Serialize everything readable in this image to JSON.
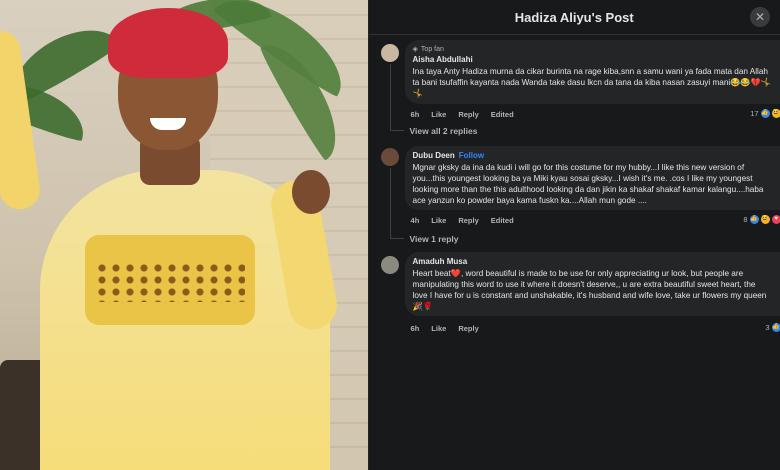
{
  "post": {
    "title": "Hadiza Aliyu's Post"
  },
  "icons": {
    "close": "close-icon",
    "top_fan": "top-fan-badge-icon"
  },
  "colors": {
    "like": "#2d88ff",
    "love": "#f33e58",
    "haha": "#f7b125",
    "follow": "#2d88ff"
  },
  "comments": [
    {
      "badge": "Top fan",
      "name": "Aisha Abdullahi",
      "text": "Ina taya Anty Hadiza murna da cikar burinta na rage kiba,snn a samu wani ya fada mata dan Allah ta bani tsufaffin kayanta nada Wanda take dasu lkcn da tana da kiba nasan zasuyi mani😂😂💔🤸🤸",
      "time": "6h",
      "like": "Like",
      "reply": "Reply",
      "edited": "Edited",
      "reactions": "17",
      "view_replies": "View all 2 replies"
    },
    {
      "name": "Dubu Deen",
      "follow": "Follow",
      "text": "Mgnar gksky da ina da kudi i will go for this costume for my hubby...I like this new version of you...this youngest looking ba ya Miki kyau sosai gksky...I wish it's me. .cos I like my youngest looking more than the this adulthood looking da dan jikin ka shakaf shakaf kamar kalangu....haba ace yanzun ko powder baya kama fuskn ka....Allah mun gode ....",
      "time": "4h",
      "like": "Like",
      "reply": "Reply",
      "edited": "Edited",
      "reactions": "8",
      "view_replies": "View 1 reply"
    },
    {
      "name": "Amaduh Musa",
      "text": "Heart beat❤️, word beautiful is made to be use for only appreciating ur look, but people are manipulating this word to use it where it doesn't deserve,, u are extra beautiful sweet heart, the love I have for u is constant and unshakable, it's husband and wife love, take ur flowers my queen🎉🌹",
      "time": "6h",
      "like": "Like",
      "reply": "Reply",
      "reactions": "3"
    }
  ]
}
